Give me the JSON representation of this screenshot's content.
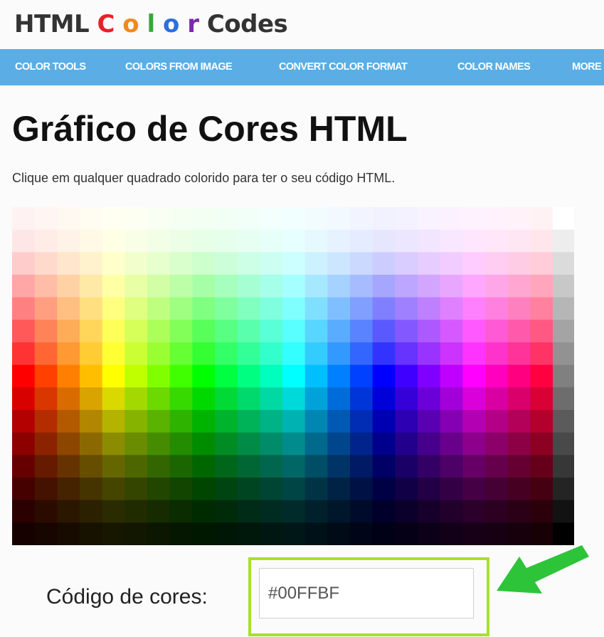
{
  "logo": {
    "parts": [
      {
        "text": "HTML ",
        "color": "#333333"
      },
      {
        "text": "C",
        "color": "#e8202a"
      },
      {
        "text": "o",
        "color": "#f08a1c"
      },
      {
        "text": "l",
        "color": "#3aa63a"
      },
      {
        "text": "o",
        "color": "#2c6fdc"
      },
      {
        "text": "r",
        "color": "#7b2aa8"
      },
      {
        "text": " Codes",
        "color": "#333333"
      }
    ]
  },
  "nav": {
    "items": [
      {
        "label": "COLOR TOOLS"
      },
      {
        "label": "COLORS FROM IMAGE"
      },
      {
        "label": "CONVERT COLOR FORMAT"
      },
      {
        "label": "COLOR NAMES"
      },
      {
        "label": "MORE"
      }
    ],
    "background": "#5aaee5"
  },
  "page": {
    "title": "Gráfico de Cores HTML",
    "subtitle": "Clique em qualquer quadrado colorido para ter o seu código HTML."
  },
  "color_code": {
    "label": "Código de cores:",
    "value": "#00FFBF",
    "highlight_color": "#a8e02c",
    "arrow_color": "#2ec43a"
  }
}
